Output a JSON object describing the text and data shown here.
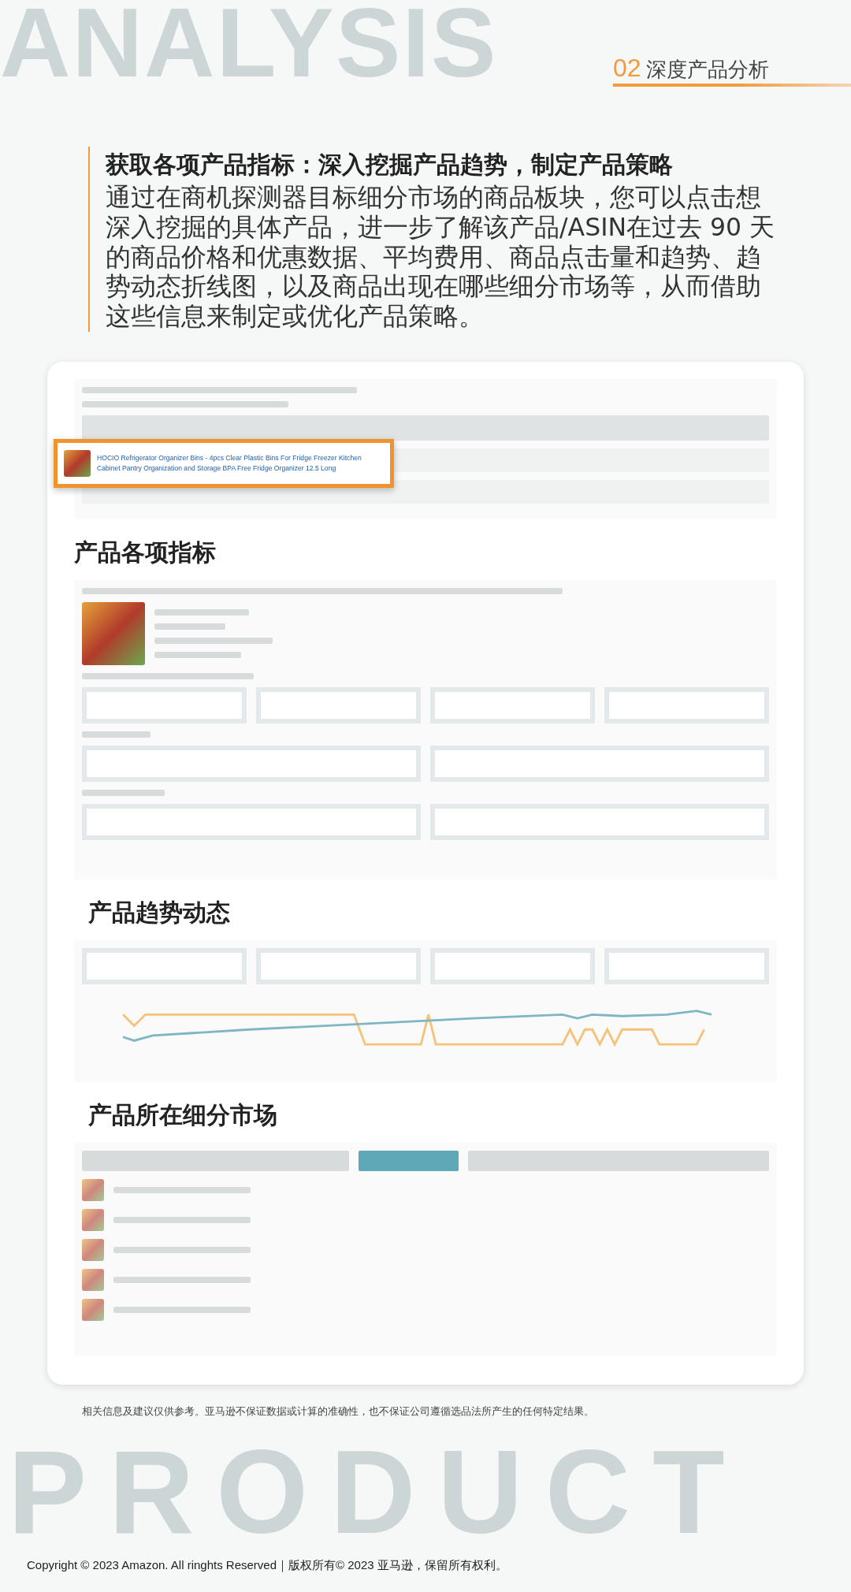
{
  "background_words": [
    "ANALYSIS",
    "PRODUCT"
  ],
  "header": {
    "number": "02",
    "title": "深度产品分析"
  },
  "intro": {
    "title": "获取各项产品指标：深入挖掘产品趋势，制定产品策略",
    "body": "通过在商机探测器目标细分市场的商品板块，您可以点击想深入挖掘的具体产品，进一步了解该产品/ASIN在过去 90 天的商品价格和优惠数据、平均费用、商品点击量和趋势、趋势动态折线图，以及商品出现在哪些细分市场等，从而借助这些信息来制定或优化产品策略。"
  },
  "card": {
    "blocks": [
      {
        "kind": "results",
        "highlight": "HOCIO Refrigerator Organizer Bins - 4pcs Clear Plastic Bins For Fridge Freezer Kitchen Cabinet Pantry Organization and Storage BPA Free Fridge Organizer 12.5 Long"
      },
      {
        "kind": "metrics",
        "heading": "产品各项指标"
      },
      {
        "kind": "trend",
        "heading": "产品趋势动态"
      },
      {
        "kind": "segments",
        "heading": "产品所在细分市场"
      }
    ]
  },
  "disclaimer": "相关信息及建议仅供参考。亚马逊不保证数据或计算的准确性，也不保证公司遵循选品法所产生的任何特定结果。",
  "copyright": "Copyright © 2023 Amazon. All ringhts Reserved｜版权所有© 2023 亚马逊，保留所有权利。"
}
